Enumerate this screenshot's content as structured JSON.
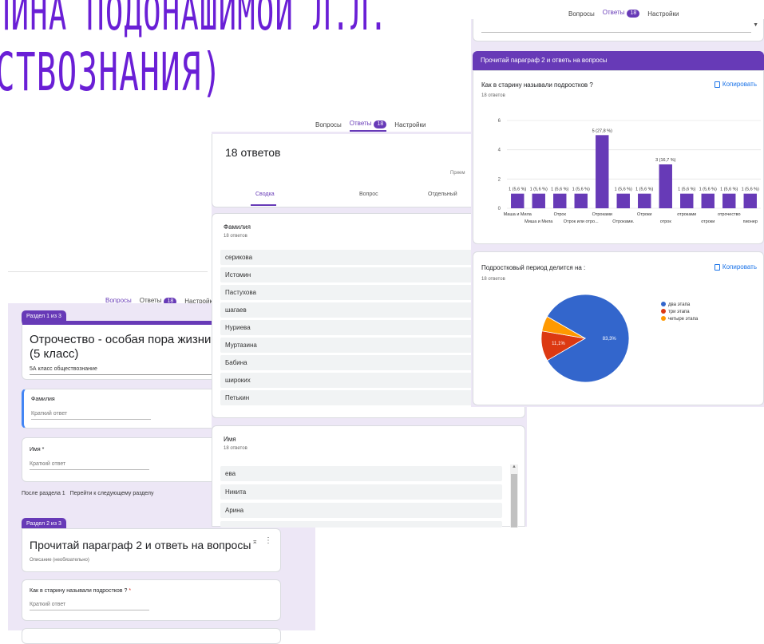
{
  "background_title": {
    "line1": "ПИНА ПОДОНАШИМОЙ Л.Л.",
    "line2": "СТВОЗНАНИЯ)"
  },
  "tabs": {
    "questions": "Вопросы",
    "answers": "Ответы",
    "answers_count": "18",
    "settings": "Настройки"
  },
  "responses_panel": {
    "title": "18 ответов",
    "accept_label": "Прием",
    "subtabs": [
      "Сводка",
      "Вопрос",
      "Отдельный"
    ],
    "surname_question": "Фамилия",
    "surname_count": "18 ответов",
    "surnames": [
      "серикова",
      "Истомин",
      "Пастухова",
      "шагаев",
      "Нуриева",
      "Муртазина",
      "Бабина",
      "широких",
      "Петькин"
    ],
    "name_question": "Имя",
    "name_count": "18 ответов",
    "names": [
      "ева",
      "Никита",
      "Арина"
    ]
  },
  "form_editor": {
    "section1_tag": "Раздел 1 из 3",
    "form_title": "Отрочество - особая пора жизни (5 класс)",
    "form_description": "5А класс обществознание",
    "surname_label": "Фамилия",
    "short_answer": "Краткий ответ",
    "name_label": "Имя *",
    "after_section": "После раздела 1",
    "after_section_action": "Перейти к следующему разделу",
    "section2_tag": "Раздел 2 из 3",
    "section2_title": "Прочитай параграф 2 и ответь на вопросы",
    "section2_desc": "Описание (необязательно)",
    "q_label": "Как в старину называли подростков ?",
    "q_required_mark": "*"
  },
  "summary_panel": {
    "section_header": "Прочитай параграф 2 и ответь на вопросы",
    "copy_label": "Копировать"
  },
  "chart_data": [
    {
      "type": "bar",
      "title": "Как в старину называли подростков ?",
      "subtitle": "18 ответов",
      "categories": [
        "Маша и Мила",
        "Миша и Мила",
        "Отрок",
        "Отрок или отро...",
        "Отроками",
        "Отроками.",
        "Отроки",
        "отрок",
        "отроками",
        "отроки",
        "отрочество",
        "пионер"
      ],
      "values": [
        1,
        1,
        1,
        1,
        5,
        1,
        1,
        3,
        1,
        1,
        1,
        1
      ],
      "data_labels": [
        "1 (5,6 %)",
        "1 (5,6 %)",
        "1 (5,6 %)",
        "1 (5,6 %)",
        "5 (27,8 %)",
        "1 (5,6 %)",
        "1 (5,6 %)",
        "3 (16,7 %)",
        "1 (5,6 %)",
        "1 (5,6 %)",
        "1 (5,6 %)",
        "1 (5,6 %)"
      ],
      "yticks": [
        0,
        2,
        4,
        6
      ],
      "ylim": [
        0,
        6
      ],
      "color": "#673ab7"
    },
    {
      "type": "pie",
      "title": "Подростковый период делится на :",
      "subtitle": "18 ответов",
      "labels": [
        "два этапа",
        "три этапа",
        "четыре этапа"
      ],
      "values": [
        83.3,
        11.1,
        5.6
      ],
      "slice_labels": [
        "83,3%",
        "11,1%",
        ""
      ],
      "colors": [
        "#3366cc",
        "#dc3912",
        "#ff9900"
      ],
      "legend": "right"
    }
  ]
}
